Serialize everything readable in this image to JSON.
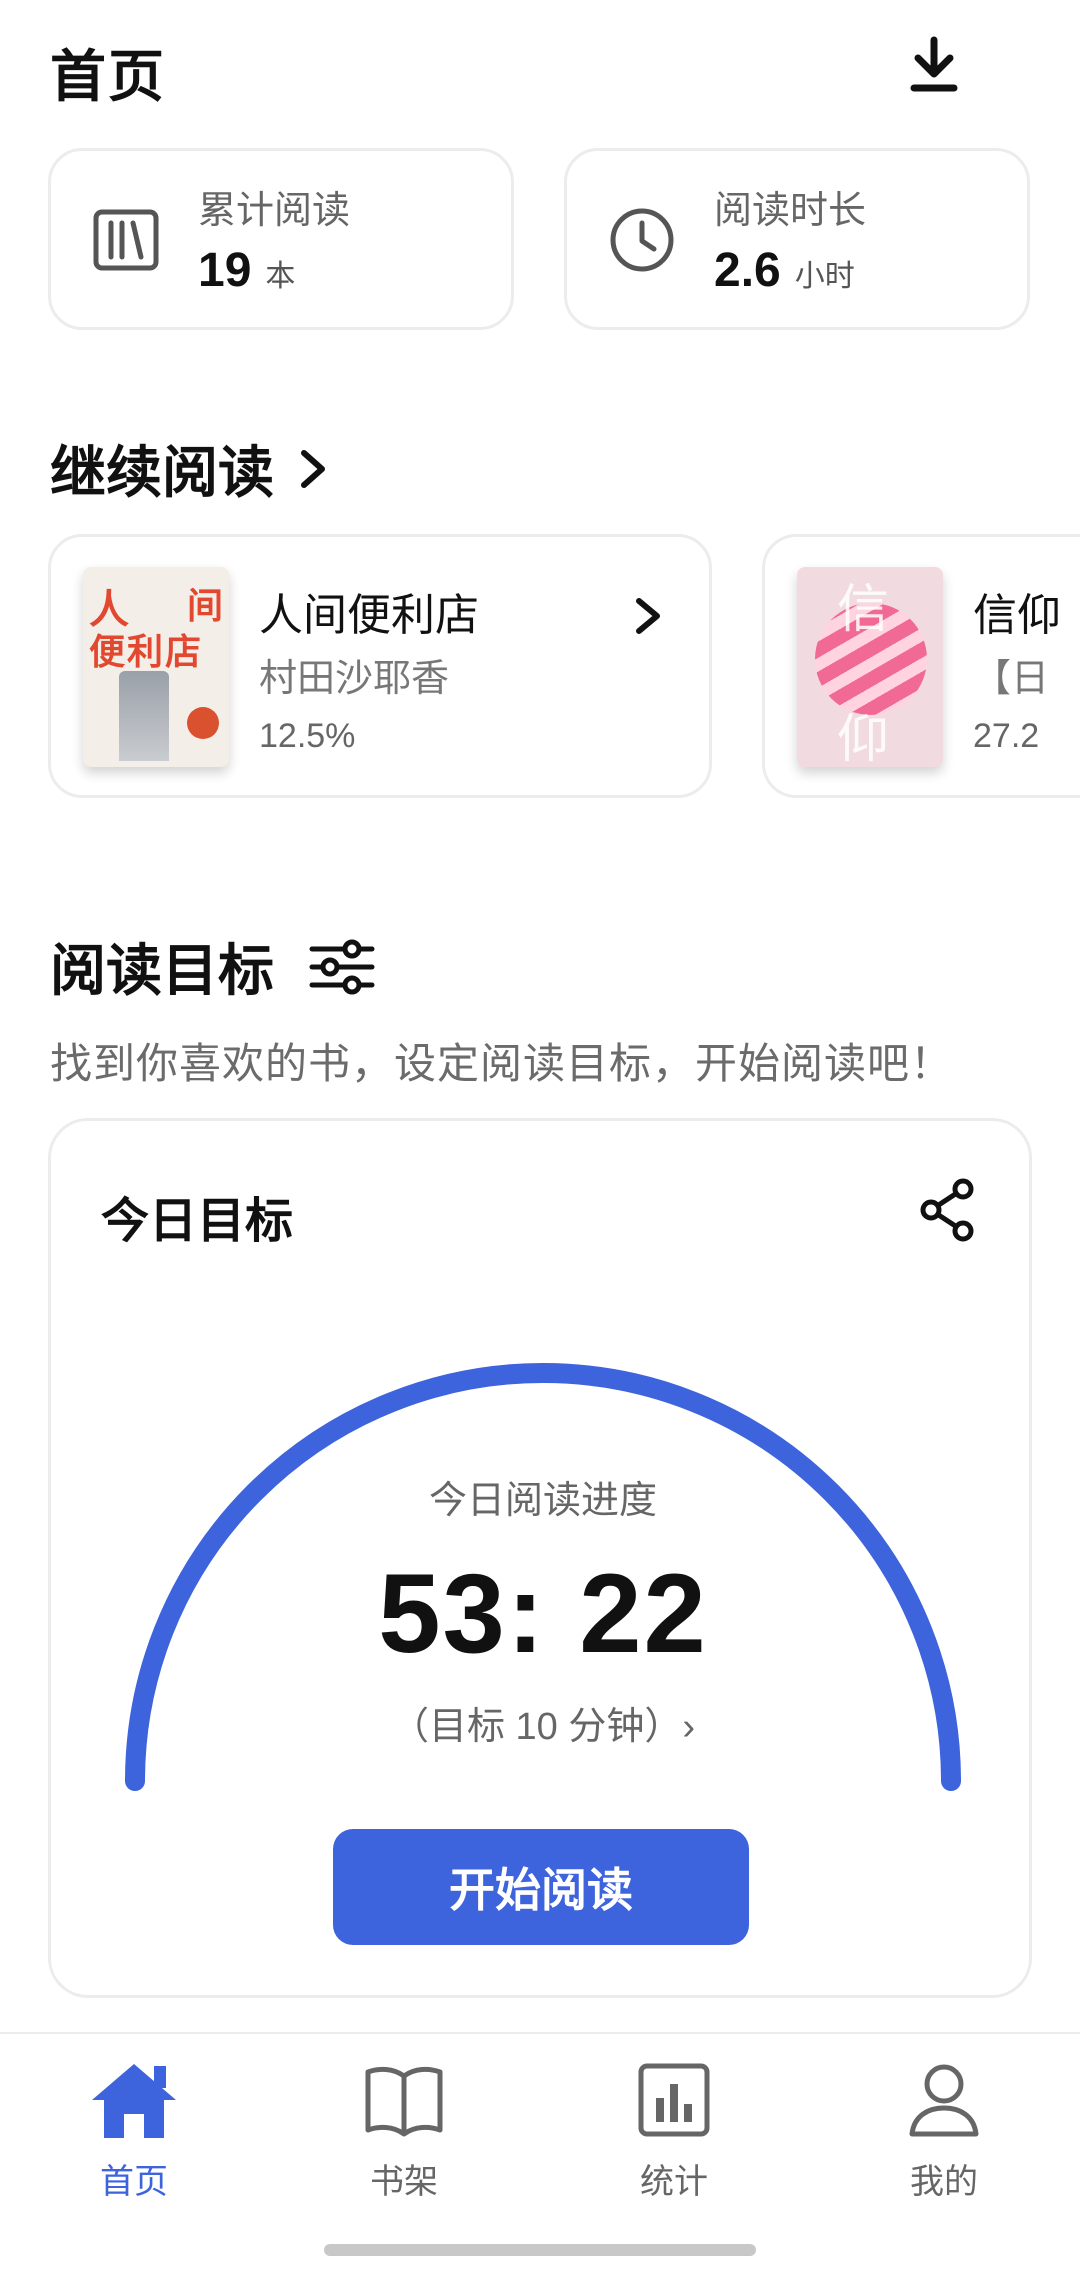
{
  "header": {
    "title": "首页",
    "download_icon": "download-icon"
  },
  "stats": [
    {
      "label": "累计阅读",
      "value": "19",
      "unit": "本",
      "icon": "bookshelf-icon"
    },
    {
      "label": "阅读时长",
      "value": "2.6",
      "unit": "小时",
      "icon": "clock-icon"
    }
  ],
  "continue_reading": {
    "title": "继续阅读",
    "books": [
      {
        "title": "人间便利店",
        "author": "村田沙耶香",
        "progress": "12.5%"
      },
      {
        "title": "信仰",
        "author": "【日",
        "progress": "27.2"
      }
    ]
  },
  "covers": {
    "a_line1_left": "人",
    "a_line1_right": "间",
    "a_line2": "便利店",
    "b_char1": "信",
    "b_char2": "仰"
  },
  "goals": {
    "title": "阅读目标",
    "subtitle": "找到你喜欢的书，设定阅读目标，开始阅读吧！",
    "today": {
      "title": "今日目标",
      "progress_label": "今日阅读进度",
      "time": "53: 22",
      "goal_text": "（目标 10 分钟）›",
      "start_button": "开始阅读",
      "gauge_fraction": 1.0
    }
  },
  "nav": [
    {
      "label": "首页",
      "icon": "home-icon",
      "active": true
    },
    {
      "label": "书架",
      "icon": "book-icon",
      "active": false
    },
    {
      "label": "统计",
      "icon": "stats-icon",
      "active": false
    },
    {
      "label": "我的",
      "icon": "profile-icon",
      "active": false
    }
  ],
  "colors": {
    "accent": "#3d63dd",
    "text": "#111111",
    "muted": "#666666",
    "border": "#ececec"
  }
}
